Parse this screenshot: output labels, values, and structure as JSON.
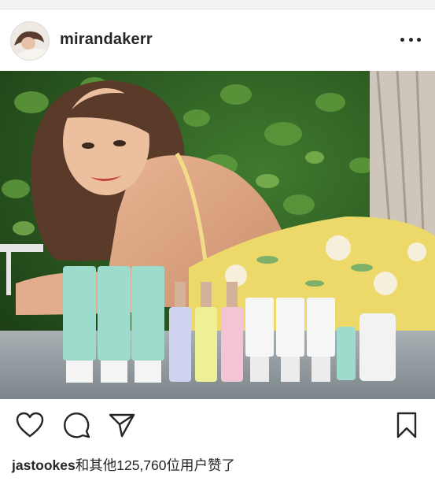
{
  "post": {
    "username": "mirandakerr",
    "liked_by_user": "jastookes",
    "liked_by_rest": "和其他125,760位用户赞了",
    "more_icon": "more-horizontal-icon"
  },
  "icons": [
    "heart-icon",
    "comment-icon",
    "share-icon",
    "bookmark-icon"
  ],
  "colors": {
    "text": "#262626",
    "background": "#ffffff"
  }
}
